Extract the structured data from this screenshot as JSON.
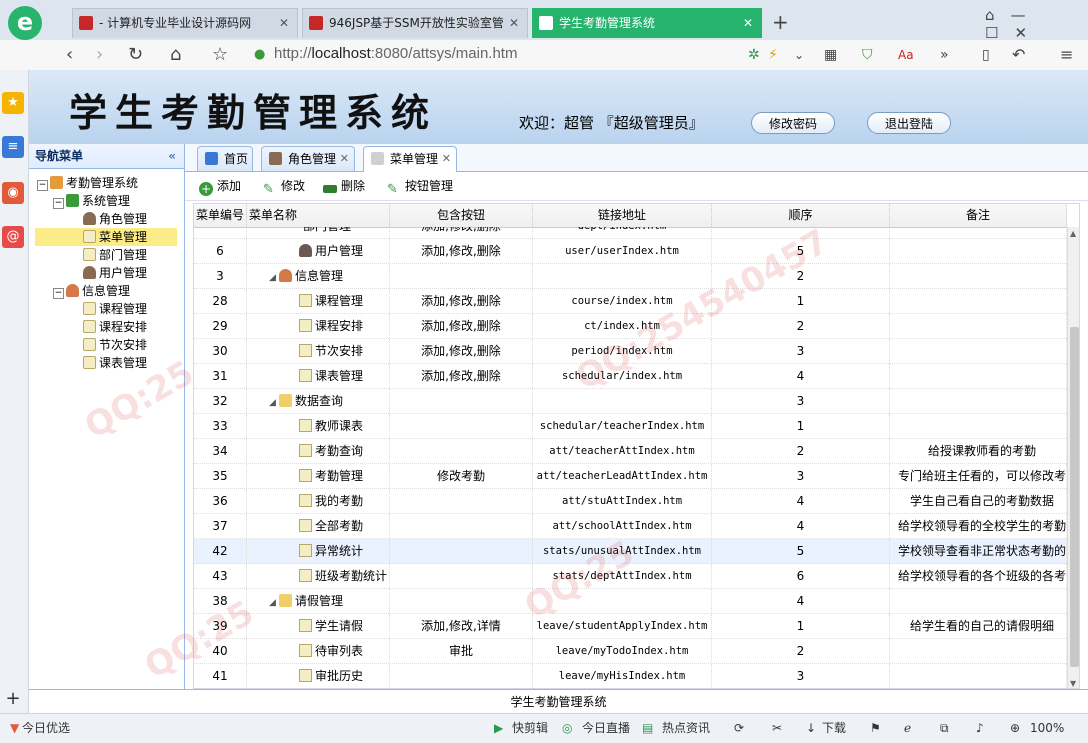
{
  "browser": {
    "tabs": [
      {
        "label": "- 计算机专业毕业设计源码网"
      },
      {
        "label": "946JSP基于SSM开放性实验室管"
      },
      {
        "label": "学生考勤管理系统"
      }
    ],
    "new_tab": "+",
    "url_scheme": "http://",
    "url_host": "localhost",
    "url_rest": ":8080/attsys/main.htm"
  },
  "app": {
    "title": "学生考勤管理系统",
    "welcome": "欢迎：超管 『超级管理员』",
    "change_password": "修改密码",
    "logout": "退出登陆"
  },
  "nav": {
    "header": "导航菜单",
    "tree": [
      {
        "label": "考勤管理系统",
        "icon": "home-icon"
      },
      {
        "label": "系统管理",
        "icon": "settings-icon"
      },
      {
        "label": "角色管理",
        "icon": "user-icon"
      },
      {
        "label": "菜单管理",
        "icon": "document-icon"
      },
      {
        "label": "部门管理",
        "icon": "document-icon"
      },
      {
        "label": "用户管理",
        "icon": "user-icon"
      },
      {
        "label": "信息管理",
        "icon": "group-icon"
      },
      {
        "label": "课程管理",
        "icon": "document-icon"
      },
      {
        "label": "课程安排",
        "icon": "document-icon"
      },
      {
        "label": "节次安排",
        "icon": "document-icon"
      },
      {
        "label": "课表管理",
        "icon": "document-icon"
      }
    ]
  },
  "content_tabs": [
    {
      "label": "首页"
    },
    {
      "label": "角色管理"
    },
    {
      "label": "菜单管理"
    }
  ],
  "toolbar": {
    "add": "添加",
    "edit": "修改",
    "delete": "删除",
    "buttons": "按钮管理"
  },
  "grid": {
    "columns": [
      "菜单编号",
      "菜单名称",
      "包含按钮",
      "链接地址",
      "顺序",
      "备注"
    ],
    "partial_row": {
      "name": "部门管理",
      "buttons": "添加,修改,删除",
      "url": "dept/index.htm"
    },
    "rows": [
      {
        "id": "6",
        "name": "用户管理",
        "buttons": "添加,修改,删除",
        "url": "user/userIndex.htm",
        "order": "5",
        "remark": ""
      },
      {
        "id": "3",
        "name": "信息管理",
        "buttons": "",
        "url": "",
        "order": "2",
        "remark": ""
      },
      {
        "id": "28",
        "name": "课程管理",
        "buttons": "添加,修改,删除",
        "url": "course/index.htm",
        "order": "1",
        "remark": ""
      },
      {
        "id": "29",
        "name": "课程安排",
        "buttons": "添加,修改,删除",
        "url": "ct/index.htm",
        "order": "2",
        "remark": ""
      },
      {
        "id": "30",
        "name": "节次安排",
        "buttons": "添加,修改,删除",
        "url": "period/index.htm",
        "order": "3",
        "remark": ""
      },
      {
        "id": "31",
        "name": "课表管理",
        "buttons": "添加,修改,删除",
        "url": "schedular/index.htm",
        "order": "4",
        "remark": ""
      },
      {
        "id": "32",
        "name": "数据查询",
        "buttons": "",
        "url": "",
        "order": "3",
        "remark": ""
      },
      {
        "id": "33",
        "name": "教师课表",
        "buttons": "",
        "url": "schedular/teacherIndex.htm",
        "order": "1",
        "remark": ""
      },
      {
        "id": "34",
        "name": "考勤查询",
        "buttons": "",
        "url": "att/teacherAttIndex.htm",
        "order": "2",
        "remark": "给授课教师看的考勤"
      },
      {
        "id": "35",
        "name": "考勤管理",
        "buttons": "修改考勤",
        "url": "att/teacherLeadAttIndex.htm",
        "order": "3",
        "remark": "专门给班主任看的，可以修改考勤"
      },
      {
        "id": "36",
        "name": "我的考勤",
        "buttons": "",
        "url": "att/stuAttIndex.htm",
        "order": "4",
        "remark": "学生自己看自己的考勤数据"
      },
      {
        "id": "37",
        "name": "全部考勤",
        "buttons": "",
        "url": "att/schoolAttIndex.htm",
        "order": "4",
        "remark": "给学校领导看的全校学生的考勤"
      },
      {
        "id": "42",
        "name": "异常统计",
        "buttons": "",
        "url": "stats/unusualAttIndex.htm",
        "order": "5",
        "remark": "学校领导查看非正常状态考勤的次"
      },
      {
        "id": "43",
        "name": "班级考勤统计",
        "buttons": "",
        "url": "stats/deptAttIndex.htm",
        "order": "6",
        "remark": "给学校领导看的各个班级的各考勤"
      },
      {
        "id": "38",
        "name": "请假管理",
        "buttons": "",
        "url": "",
        "order": "4",
        "remark": ""
      },
      {
        "id": "39",
        "name": "学生请假",
        "buttons": "添加,修改,详情",
        "url": "leave/studentApplyIndex.htm",
        "order": "1",
        "remark": "给学生看的自己的请假明细"
      },
      {
        "id": "40",
        "name": "待审列表",
        "buttons": "审批",
        "url": "leave/myTodoIndex.htm",
        "order": "2",
        "remark": ""
      },
      {
        "id": "41",
        "name": "审批历史",
        "buttons": "",
        "url": "leave/myHisIndex.htm",
        "order": "3",
        "remark": ""
      }
    ]
  },
  "footer": "学生考勤管理系统",
  "statusbar": {
    "news": "今日优选",
    "clip": "快剪辑",
    "live": "今日直播",
    "hot": "热点资讯",
    "download": "下载",
    "zoom": "100%"
  },
  "colors": {
    "accent": "#26b36e",
    "header_blue": "#b9d3ee",
    "border_blue": "#95b8e7",
    "selected": "#fbec88"
  }
}
